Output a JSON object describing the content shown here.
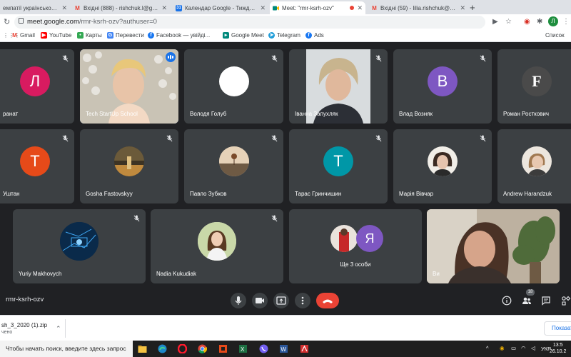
{
  "browser": {
    "tabs": [
      {
        "title": "емпатії українською – По",
        "icon": "doc-icon",
        "color": "#4285f4"
      },
      {
        "title": "Вхідні (888) - rishchuk.l@gmail.c",
        "icon": "gmail-icon",
        "color": "#ea4335"
      },
      {
        "title": "Календар Google - Тиждень (2",
        "icon": "calendar-icon",
        "color": "#1a73e8"
      },
      {
        "title": "Meet: \"rmr-ksrh-ozv\"",
        "icon": "meet-icon",
        "color": "#00897b"
      },
      {
        "title": "Вхідні (59) - lilia.rishchuk@nung",
        "icon": "gmail-icon",
        "color": "#ea4335"
      }
    ],
    "url_host": "meet.google.com",
    "url_path": "/rmr-ksrh-ozv?authuser=0",
    "profile_letter": "Л",
    "bookmarks": [
      {
        "label": "Gmail",
        "icon": "gmail-icon",
        "color": "#ea4335"
      },
      {
        "label": "YouTube",
        "icon": "youtube-icon",
        "color": "#ff0000"
      },
      {
        "label": "Карты",
        "icon": "maps-icon",
        "color": "#34a853"
      },
      {
        "label": "Перевести",
        "icon": "translate-icon",
        "color": "#4285f4"
      },
      {
        "label": "Facebook — увійді...",
        "icon": "facebook-icon",
        "color": "#1877f2"
      },
      {
        "label": "Google Meet",
        "icon": "meet-icon",
        "color": "#00897b"
      },
      {
        "label": "Telegram",
        "icon": "telegram-icon",
        "color": "#229ed9"
      },
      {
        "label": "Ads",
        "icon": "facebook-icon",
        "color": "#1877f2"
      }
    ],
    "bookmarks_other": "Список"
  },
  "meet": {
    "participants": [
      {
        "name": "ранат",
        "letter": "Л",
        "avatar_color": "#d81b60",
        "kind": "letter"
      },
      {
        "name": "Tech StartUp School",
        "kind": "video",
        "speaking": true
      },
      {
        "name": "Володя Голуб",
        "letter": "",
        "avatar_color": "#ffffff",
        "kind": "letter"
      },
      {
        "name": "Іванна Запухляк",
        "kind": "video"
      },
      {
        "name": "Влад Возняк",
        "letter": "В",
        "avatar_color": "#7e57c2",
        "kind": "letter"
      },
      {
        "name": "Роман Росткович",
        "letter": "F",
        "avatar_color": "#4a4a4a",
        "kind": "letter"
      },
      {
        "name": "Уштан",
        "letter": "Т",
        "avatar_color": "#e64a19",
        "kind": "letter"
      },
      {
        "name": "Gosha Fastovskyy",
        "kind": "photo"
      },
      {
        "name": "Павло Зубков",
        "kind": "photo"
      },
      {
        "name": "Тарас Гринчишин",
        "letter": "Т",
        "avatar_color": "#0097a7",
        "kind": "letter"
      },
      {
        "name": "Марія Вівчар",
        "kind": "photo"
      },
      {
        "name": "Andrew Harandzuk",
        "kind": "photo"
      },
      {
        "name": "Yuriy Makhovych",
        "kind": "photo"
      },
      {
        "name": "Nadia Kukudiak",
        "kind": "photo"
      },
      {
        "name": "Ще 3 особи",
        "letter": "Я",
        "avatar_color": "#7e57c2",
        "kind": "group"
      },
      {
        "name": "Ви",
        "kind": "video"
      }
    ],
    "meeting_code": "rmr-ksrh-ozv",
    "participants_count": "18"
  },
  "downloads": {
    "file": "sh_3_2020 (1).zip",
    "status": "чено",
    "show_all": "Показат"
  },
  "taskbar": {
    "search_placeholder": "Чтобы начать поиск, введите здесь запрос",
    "lang": "УКР",
    "time": "13:5",
    "date": "26.10.2"
  }
}
